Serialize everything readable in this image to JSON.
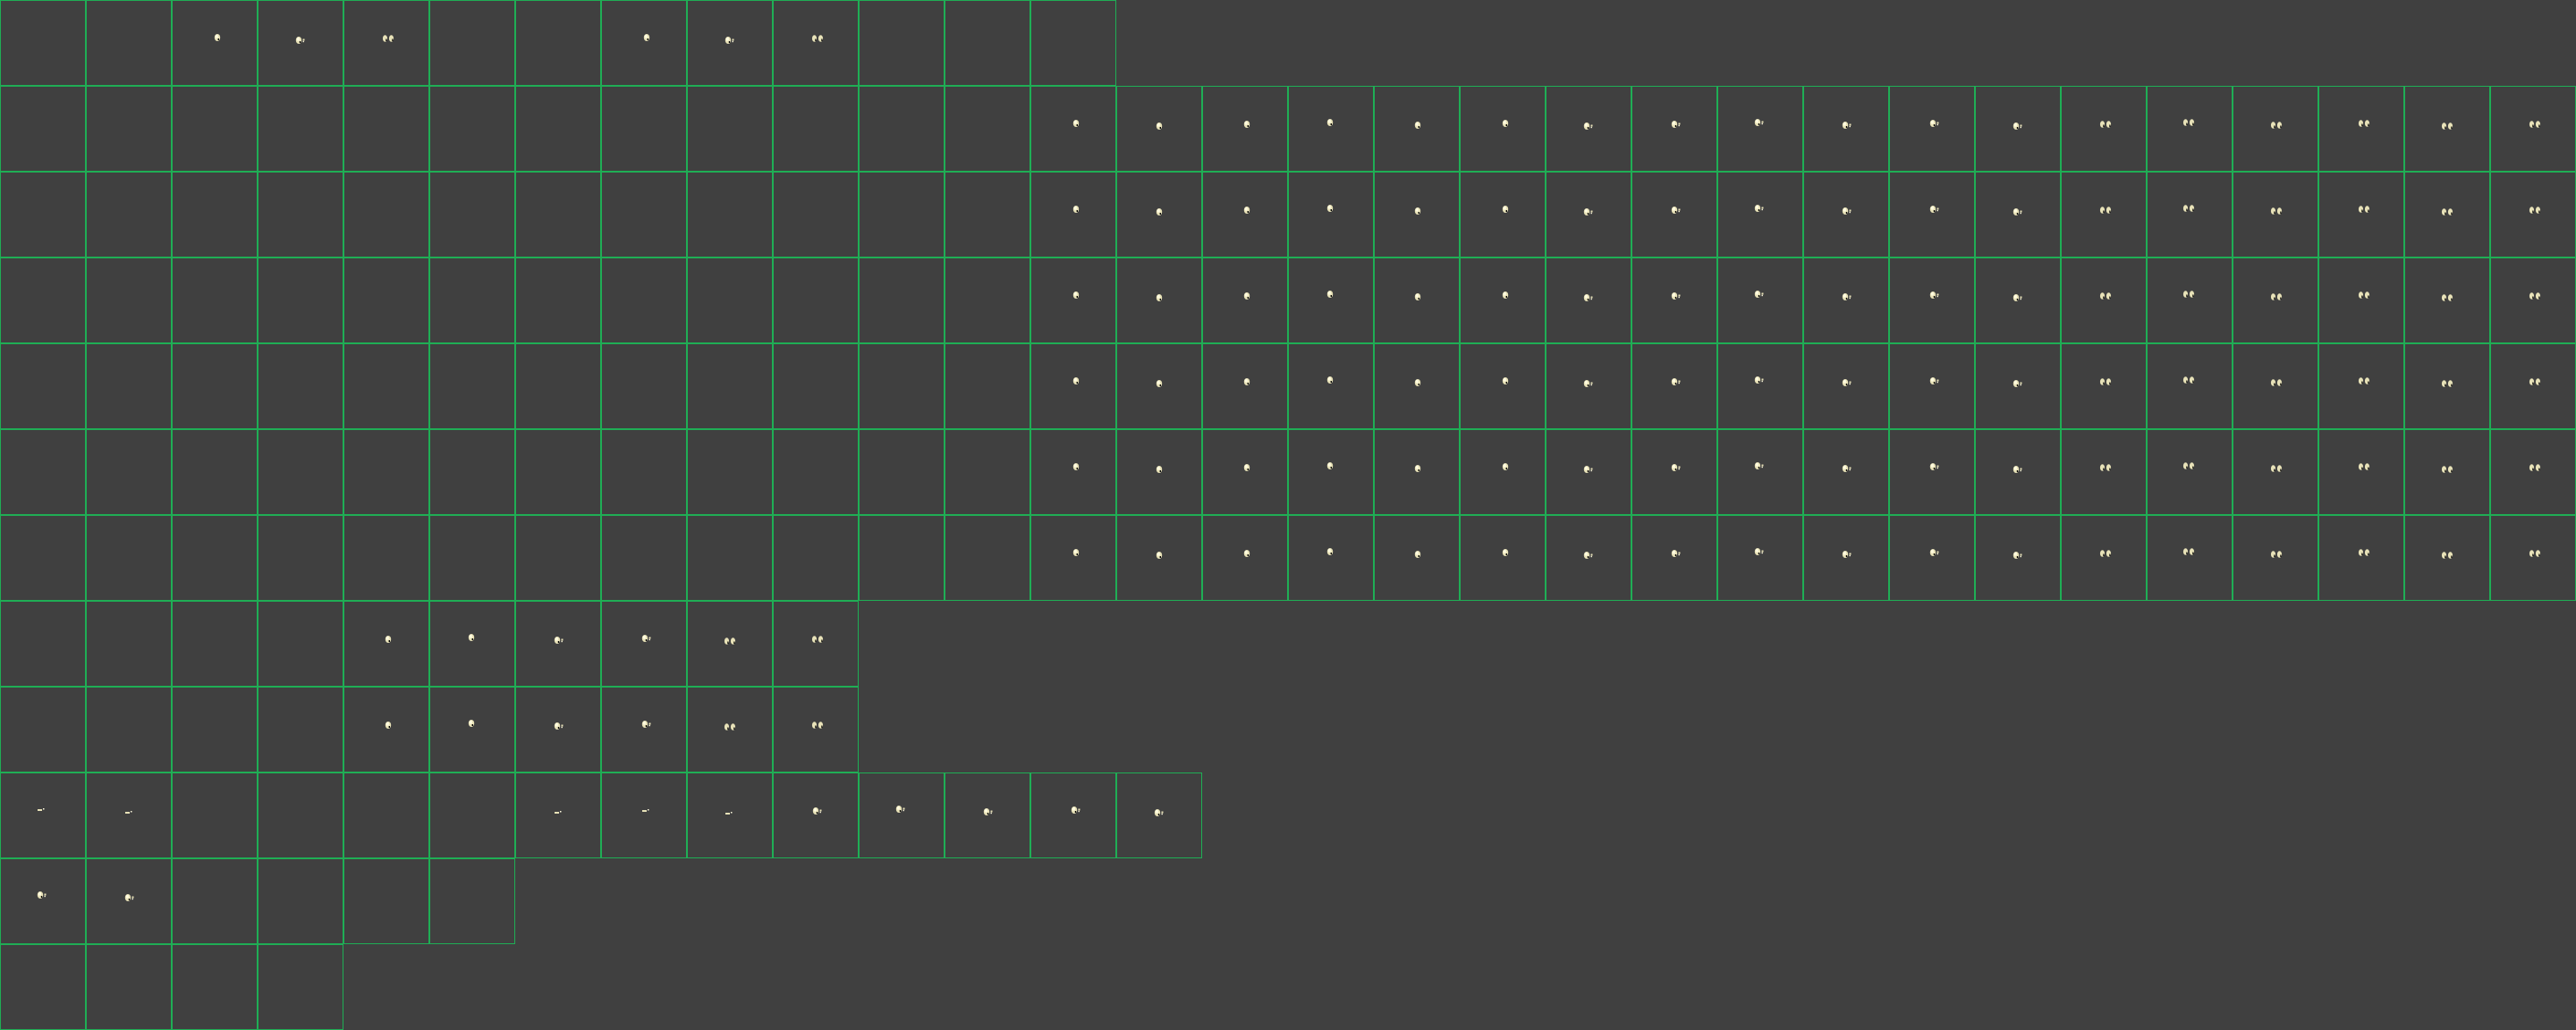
{
  "sprite_sheet": {
    "background_color": "#404040",
    "grid_line_color": "#1fae55",
    "sprite_colors": {
      "highlight": "#fffbe0",
      "body": "#e8e2b8",
      "shade": "#000000"
    },
    "icon": "head-sprite-icon",
    "rows": [
      {
        "cells": 13,
        "sprites": [
          null,
          null,
          "single",
          "double",
          "pair",
          null,
          null,
          "single",
          "double",
          "pair",
          null,
          null,
          null
        ]
      },
      {
        "cells": 30,
        "sprites": [
          null,
          null,
          null,
          null,
          null,
          null,
          null,
          null,
          null,
          null,
          null,
          null,
          "single",
          "single",
          "single",
          "single",
          "single",
          "single",
          "double",
          "double",
          "double",
          "double",
          "double",
          "double",
          "pair",
          "pair",
          "pair",
          "pair",
          "pair",
          "pair"
        ]
      },
      {
        "cells": 30,
        "sprites": [
          null,
          null,
          null,
          null,
          null,
          null,
          null,
          null,
          null,
          null,
          null,
          null,
          "single",
          "single",
          "single",
          "single",
          "single",
          "single",
          "double",
          "double",
          "double",
          "double",
          "double",
          "double",
          "pair",
          "pair",
          "pair",
          "pair",
          "pair",
          "pair"
        ]
      },
      {
        "cells": 30,
        "sprites": [
          null,
          null,
          null,
          null,
          null,
          null,
          null,
          null,
          null,
          null,
          null,
          null,
          "single",
          "single",
          "single",
          "single",
          "single",
          "single",
          "double",
          "double",
          "double",
          "double",
          "double",
          "double",
          "pair",
          "pair",
          "pair",
          "pair",
          "pair",
          "pair"
        ]
      },
      {
        "cells": 30,
        "sprites": [
          null,
          null,
          null,
          null,
          null,
          null,
          null,
          null,
          null,
          null,
          null,
          null,
          "single",
          "single",
          "single",
          "single",
          "single",
          "single",
          "double",
          "double",
          "double",
          "double",
          "double",
          "double",
          "pair",
          "pair",
          "pair",
          "pair",
          "pair",
          "pair"
        ]
      },
      {
        "cells": 30,
        "sprites": [
          null,
          null,
          null,
          null,
          null,
          null,
          null,
          null,
          null,
          null,
          null,
          null,
          "single",
          "single",
          "single",
          "single",
          "single",
          "single",
          "double",
          "double",
          "double",
          "double",
          "double",
          "double",
          "pair",
          "pair",
          "pair",
          "pair",
          "pair",
          "pair"
        ]
      },
      {
        "cells": 30,
        "sprites": [
          null,
          null,
          null,
          null,
          null,
          null,
          null,
          null,
          null,
          null,
          null,
          null,
          "single",
          "single",
          "single",
          "single",
          "single",
          "single",
          "double",
          "double",
          "double",
          "double",
          "double",
          "double",
          "pair",
          "pair",
          "pair",
          "pair",
          "pair",
          "pair"
        ]
      },
      {
        "cells": 10,
        "sprites": [
          null,
          null,
          null,
          null,
          "single",
          "single",
          "double",
          "double",
          "pair",
          "pair"
        ]
      },
      {
        "cells": 10,
        "sprites": [
          null,
          null,
          null,
          null,
          "single",
          "single",
          "double",
          "double",
          "pair",
          "pair"
        ]
      },
      {
        "cells": 14,
        "sprites": [
          "dash",
          "dash",
          null,
          null,
          null,
          null,
          "dash",
          "dash",
          "dash",
          "double",
          "double",
          "double",
          "double",
          "double"
        ]
      },
      {
        "cells": 6,
        "sprites": [
          "double",
          "double",
          null,
          null,
          null,
          null
        ]
      },
      {
        "cells": 4,
        "sprites": [
          null,
          null,
          null,
          null
        ]
      }
    ]
  }
}
